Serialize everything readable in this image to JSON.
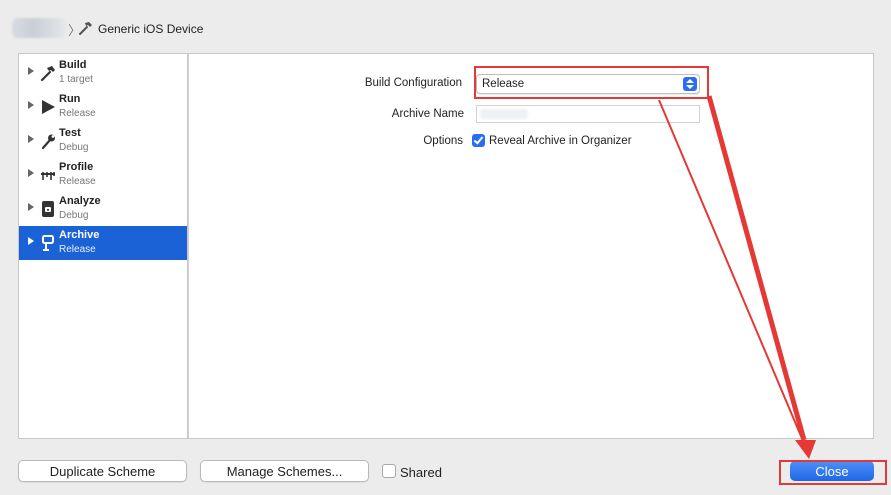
{
  "header": {
    "device_name": "Generic iOS Device"
  },
  "sidebar": {
    "items": [
      {
        "title": "Build",
        "subtitle": "1 target",
        "icon": "hammer-icon",
        "active": false
      },
      {
        "title": "Run",
        "subtitle": "Release",
        "icon": "play-icon",
        "active": false
      },
      {
        "title": "Test",
        "subtitle": "Debug",
        "icon": "wrench-icon",
        "active": false
      },
      {
        "title": "Profile",
        "subtitle": "Release",
        "icon": "gauge-icon",
        "active": false
      },
      {
        "title": "Analyze",
        "subtitle": "Debug",
        "icon": "analyze-icon",
        "active": false
      },
      {
        "title": "Archive",
        "subtitle": "Release",
        "icon": "archive-icon",
        "active": true
      }
    ]
  },
  "archive_settings": {
    "build_configuration_label": "Build Configuration",
    "build_configuration_value": "Release",
    "archive_name_label": "Archive Name",
    "archive_name_value": "",
    "options_label": "Options",
    "reveal_in_organizer_label": "Reveal Archive in Organizer",
    "reveal_in_organizer_checked": true
  },
  "footer": {
    "duplicate_label": "Duplicate Scheme",
    "manage_label": "Manage Schemes...",
    "shared_label": "Shared",
    "shared_checked": false,
    "close_label": "Close"
  },
  "colors": {
    "accent": "#1b62d6",
    "annotation": "#e53935"
  }
}
